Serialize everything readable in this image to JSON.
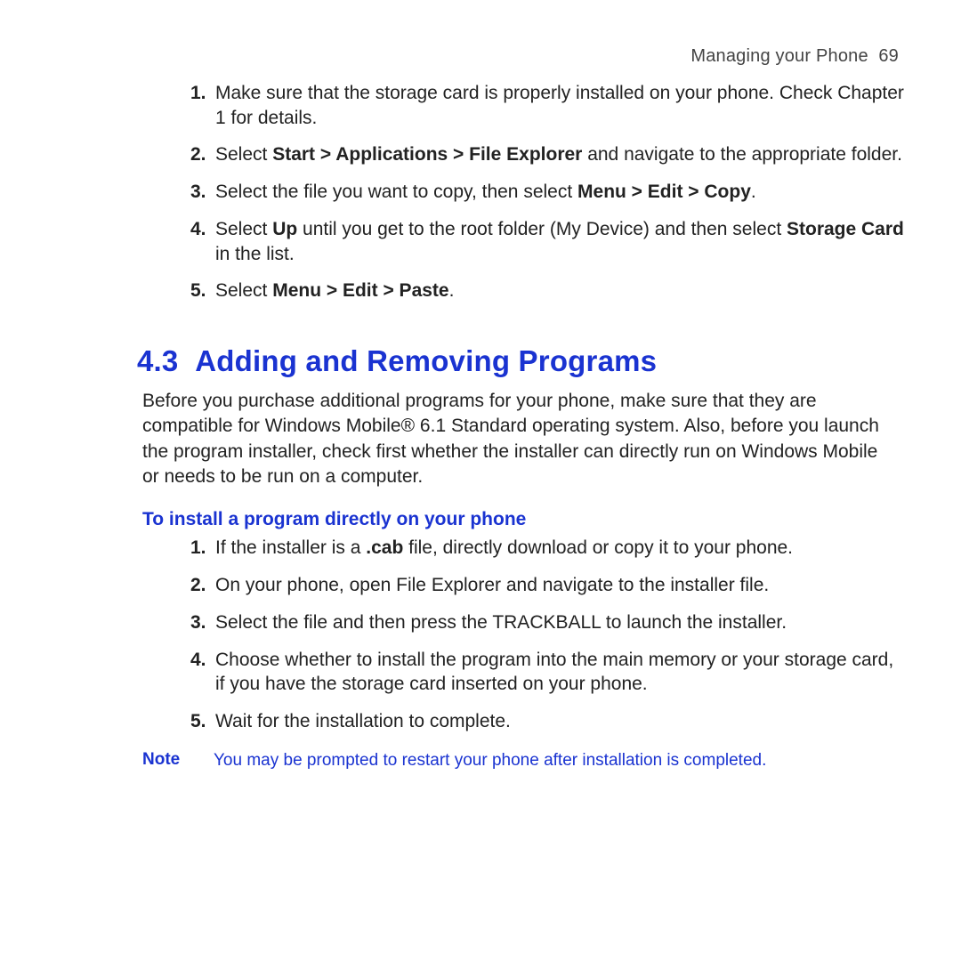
{
  "header": {
    "chapter": "Managing your Phone",
    "page_number": "69"
  },
  "steps_top": [
    {
      "num": "1.",
      "segments": [
        {
          "t": "Make sure that the storage card is properly installed on your phone. Check Chapter 1 for details."
        }
      ]
    },
    {
      "num": "2.",
      "segments": [
        {
          "t": "Select "
        },
        {
          "t": "Start > Applications > File Explorer",
          "b": true
        },
        {
          "t": " and navigate to the appropriate folder."
        }
      ]
    },
    {
      "num": "3.",
      "segments": [
        {
          "t": "Select the file you want to copy, then select "
        },
        {
          "t": "Menu > Edit > Copy",
          "b": true
        },
        {
          "t": "."
        }
      ]
    },
    {
      "num": "4.",
      "segments": [
        {
          "t": "Select "
        },
        {
          "t": "Up",
          "b": true
        },
        {
          "t": " until you get to the root folder (My Device) and then select "
        },
        {
          "t": "Storage Card",
          "b": true
        },
        {
          "t": " in the list."
        }
      ]
    },
    {
      "num": "5.",
      "segments": [
        {
          "t": "Select "
        },
        {
          "t": "Menu > Edit > Paste",
          "b": true
        },
        {
          "t": "."
        }
      ]
    }
  ],
  "section_number": "4.3",
  "section_title": "Adding and Removing Programs",
  "intro": "Before you purchase additional programs for your phone, make sure that they are compatible for Windows Mobile® 6.1 Standard operating system. Also, before you launch the program installer, check first whether the installer can directly run on Windows Mobile or needs to be run on a computer.",
  "sub_heading": "To install a program directly on your phone",
  "steps_install": [
    {
      "num": "1.",
      "segments": [
        {
          "t": "If the installer is a "
        },
        {
          "t": ".cab",
          "b": true
        },
        {
          "t": " file, directly download or copy it to your phone."
        }
      ]
    },
    {
      "num": "2.",
      "segments": [
        {
          "t": "On your phone, open File Explorer and navigate to the installer file."
        }
      ]
    },
    {
      "num": "3.",
      "segments": [
        {
          "t": "Select the file and then press the TRACKBALL to launch the installer."
        }
      ]
    },
    {
      "num": "4.",
      "segments": [
        {
          "t": "Choose whether to install the program into the main memory or your storage card, if you have the storage card inserted on your phone."
        }
      ]
    },
    {
      "num": "5.",
      "segments": [
        {
          "t": "Wait for the installation to complete."
        }
      ]
    }
  ],
  "note_label": "Note",
  "note_text": "You may be prompted to restart your phone after installation is completed."
}
